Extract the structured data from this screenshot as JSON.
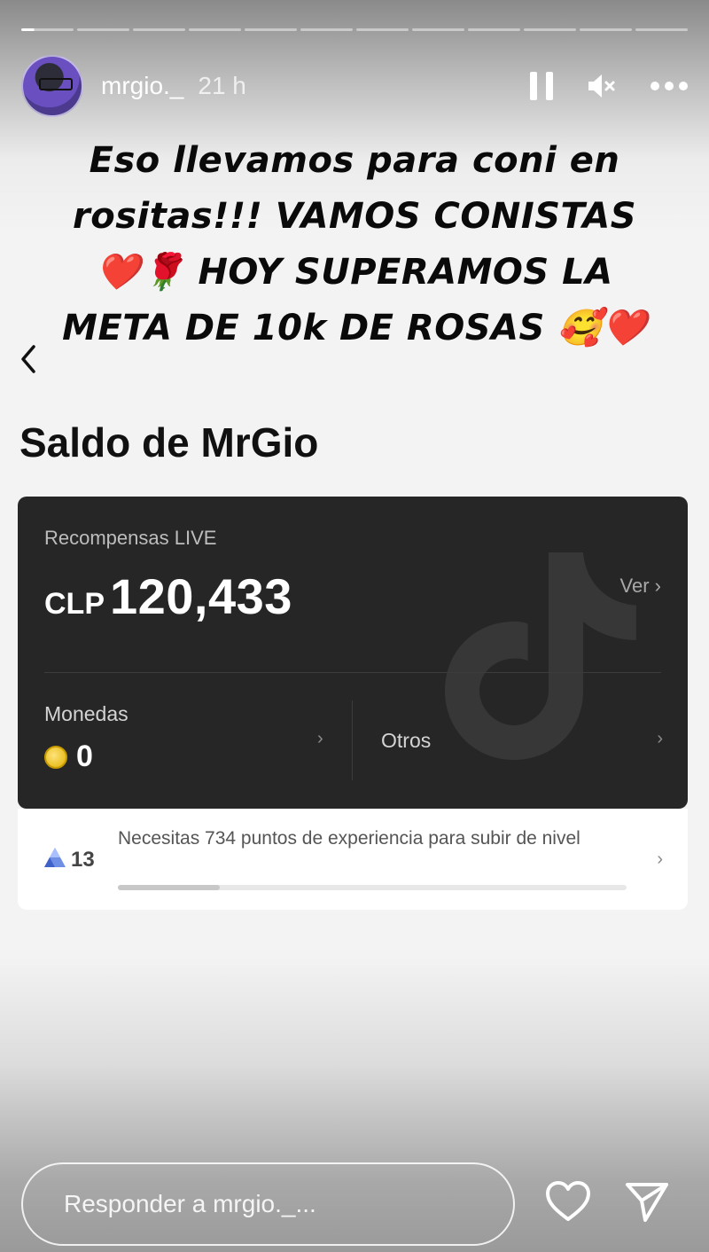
{
  "header": {
    "username": "mrgio._",
    "time": "21 h"
  },
  "caption": {
    "line1": "Eso llevamos para coni en",
    "line2": "rositas!!! VAMOS CONISTAS",
    "line3": "❤️🌹 HOY SUPERAMOS LA",
    "line4": "META DE 10k DE ROSAS 🥰❤️"
  },
  "page": {
    "title": "Saldo de MrGio"
  },
  "rewards_card": {
    "label": "Recompensas LIVE",
    "currency": "CLP",
    "amount": "120,433",
    "view_label": "Ver ›",
    "coins_label": "Monedas",
    "coins_value": "0",
    "others_label": "Otros"
  },
  "level": {
    "number": "13",
    "text": "Necesitas 734 puntos de experiencia para subir de nivel",
    "progress_fraction": 0.2
  },
  "reply": {
    "placeholder": "Responder a mrgio._..."
  },
  "icons": {
    "pause": "pause-icon",
    "mute": "mute-icon",
    "more": "more-icon",
    "back": "chevron-left-icon",
    "coin": "coin-icon",
    "level": "level-icon",
    "heart": "heart-icon",
    "send": "send-icon"
  }
}
